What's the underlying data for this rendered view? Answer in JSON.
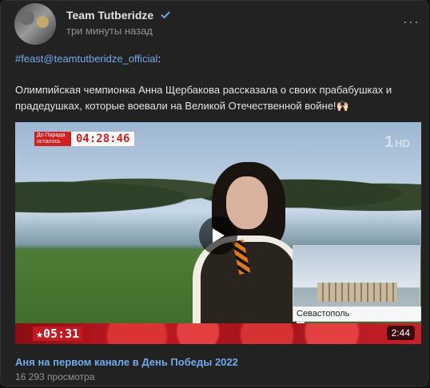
{
  "post": {
    "author": "Team Tutberidze",
    "verified_icon": "verified-check-icon",
    "time": "три минуты назад",
    "more_icon": "more-horizontal-icon",
    "more_glyph": "···",
    "hashtag": "#feast@teamtutberidze_official",
    "hashtag_suffix": ":",
    "text": "Олимпийская чемпионка Анна Щербакова рассказала о своих прабабушках и прадедушках, которые воевали на Великой Отечественной войне!",
    "emoji": "🙌🏻"
  },
  "video": {
    "countdown_label": "До Парада осталось",
    "countdown_time": "04:28:46",
    "channel_logo": "1",
    "channel_logo_suffix": "HD",
    "inset_caption": "Севастополь",
    "bottom_clock": "★05:31",
    "duration": "2:44",
    "play_icon": "play-icon",
    "title": "Аня на первом канале в День Победы 2022",
    "views": "16 293 просмотра"
  },
  "colors": {
    "background": "#141414",
    "card": "#222222",
    "link": "#71aaeb",
    "muted": "#939393",
    "text": "#e1e3e6"
  }
}
